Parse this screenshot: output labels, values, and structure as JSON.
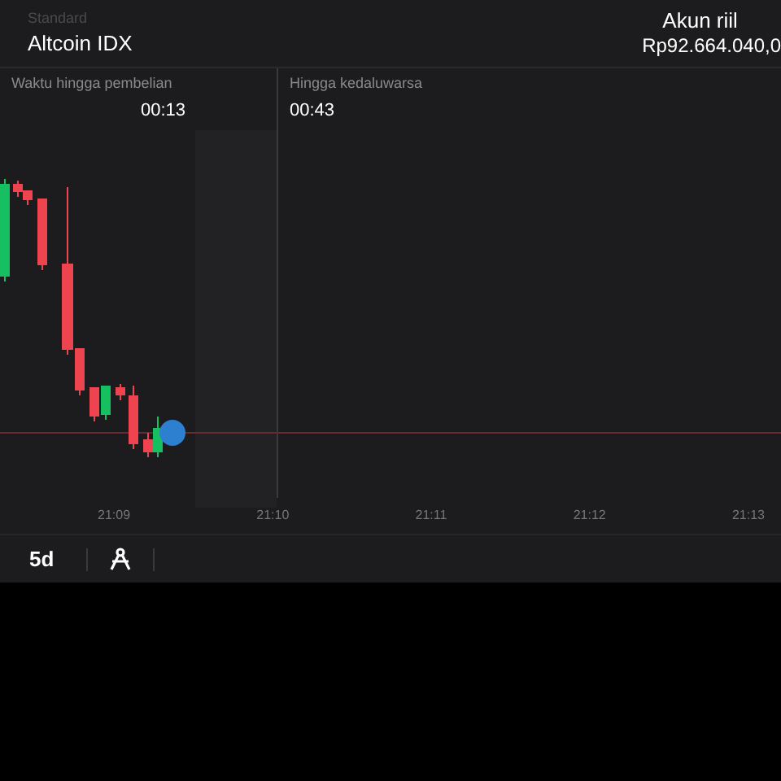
{
  "header": {
    "mode": "Standard",
    "asset": "Altcoin IDX",
    "account_label": "Akun riil",
    "balance": "Rp92.664.040,0"
  },
  "timers": [
    {
      "label": "Waktu hingga pembelian",
      "value": "00:13"
    },
    {
      "label": "Hingga kedaluwarsa",
      "value": "00:43"
    }
  ],
  "time_axis": [
    "21:09",
    "21:10",
    "21:11",
    "21:12",
    "21:13"
  ],
  "toolbar": {
    "timeframe": "5d"
  }
}
